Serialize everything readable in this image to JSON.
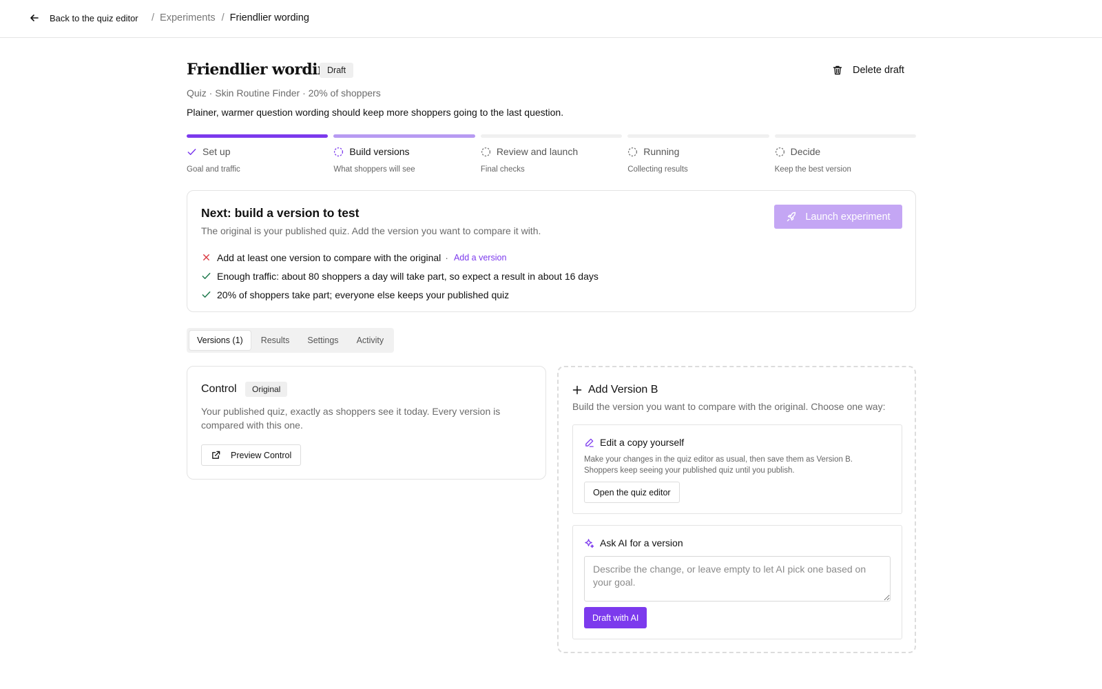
{
  "nav": {
    "back_label": "Back to the quiz editor",
    "breadcrumb": [
      "Experiments",
      "Friendlier wording"
    ]
  },
  "header": {
    "title": "Friendlier wording",
    "status": "Draft",
    "delete_label": "Delete draft",
    "meta": "Quiz · Skin Routine Finder · 20% of shoppers",
    "description": "Plainer, warmer question wording should keep more shoppers going to the last question."
  },
  "steps": [
    {
      "label": "Set up",
      "sub": "Goal and traffic",
      "state": "done"
    },
    {
      "label": "Build versions",
      "sub": "What shoppers will see",
      "state": "active"
    },
    {
      "label": "Review and launch",
      "sub": "Final checks",
      "state": "todo"
    },
    {
      "label": "Running",
      "sub": "Collecting results",
      "state": "todo"
    },
    {
      "label": "Decide",
      "sub": "Keep the best version",
      "state": "todo"
    }
  ],
  "next": {
    "title": "Next: build a version to test",
    "lead": "The original is your published quiz. Add the version you want to compare it with.",
    "launch_label": "Launch experiment",
    "checks": [
      {
        "status": "fail",
        "text": "Add at least one version to compare with the original",
        "sep": "·",
        "link": "Add a version"
      },
      {
        "status": "pass",
        "text": "Enough traffic: about 80 shoppers a day will take part, so expect a result in about 16 days"
      },
      {
        "status": "pass",
        "text": "20% of shoppers take part; everyone else keeps your published quiz"
      }
    ]
  },
  "tabs": [
    "Versions (1)",
    "Results",
    "Settings",
    "Activity"
  ],
  "control": {
    "title": "Control",
    "badge": "Original",
    "description": "Your published quiz, exactly as shoppers see it today. Every version is compared with this one.",
    "preview_label": "Preview Control"
  },
  "add_version": {
    "title": "Add Version B",
    "lead": "Build the version you want to compare with the original. Choose one way:",
    "edit": {
      "title": "Edit a copy yourself",
      "description": "Make your changes in the quiz editor as usual, then save them as Version B. Shoppers keep seeing your published quiz until you publish.",
      "button": "Open the quiz editor"
    },
    "ai": {
      "title": "Ask AI for a version",
      "placeholder": "Describe the change, or leave empty to let AI pick one based on your goal.",
      "button": "Draft with AI"
    }
  },
  "colors": {
    "accent": "#7c3aed",
    "accent_light": "#b79af2",
    "launch_disabled": "#c4a6f4",
    "fail": "#d9363e",
    "pass": "#1f7a4d"
  },
  "icons": [
    "arrow-left-icon",
    "trash-icon",
    "check-icon",
    "dashed-circle-icon",
    "rocket-icon",
    "x-icon",
    "external-link-icon",
    "plus-icon",
    "pencil-icon",
    "sparkle-icon"
  ]
}
